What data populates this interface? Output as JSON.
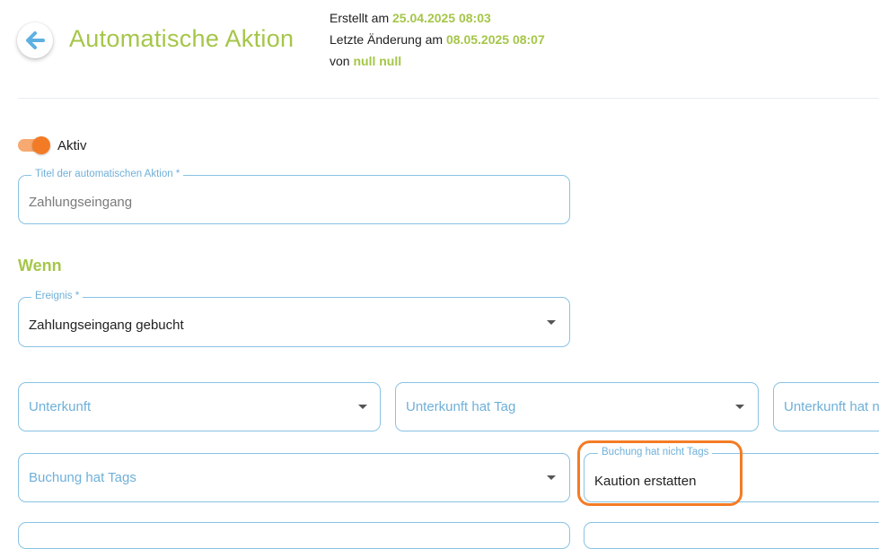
{
  "header": {
    "title": "Automatische Aktion",
    "created_label": "Erstellt am",
    "created_value": "25.04.2025 08:03",
    "modified_label": "Letzte Änderung am",
    "modified_value": "08.05.2025 08:07",
    "by_label": "von",
    "by_value": "null null"
  },
  "active_toggle": {
    "label": "Aktiv",
    "on": true
  },
  "title_field": {
    "legend": "Titel der automatischen Aktion *",
    "value": "Zahlungseingang"
  },
  "section_when": "Wenn",
  "event_field": {
    "legend": "Ereignis *",
    "value": "Zahlungseingang gebucht"
  },
  "filters": {
    "unterkunft": {
      "placeholder": "Unterkunft"
    },
    "unterkunft_hat_tag": {
      "placeholder": "Unterkunft hat Tag"
    },
    "unterkunft_hat_nicht": {
      "placeholder": "Unterkunft hat n"
    },
    "buchung_hat_tags": {
      "placeholder": "Buchung hat Tags"
    },
    "buchung_hat_nicht_tags": {
      "legend": "Buchung hat nicht Tags",
      "value": "Kaution erstatten"
    }
  },
  "colors": {
    "accent_green": "#a5c648",
    "field_blue": "#88c3e4",
    "toggle_orange": "#f47b25",
    "highlight_orange": "#f47b25"
  },
  "icons": {
    "back": "arrow-left-icon",
    "dropdown": "caret-down-icon"
  }
}
